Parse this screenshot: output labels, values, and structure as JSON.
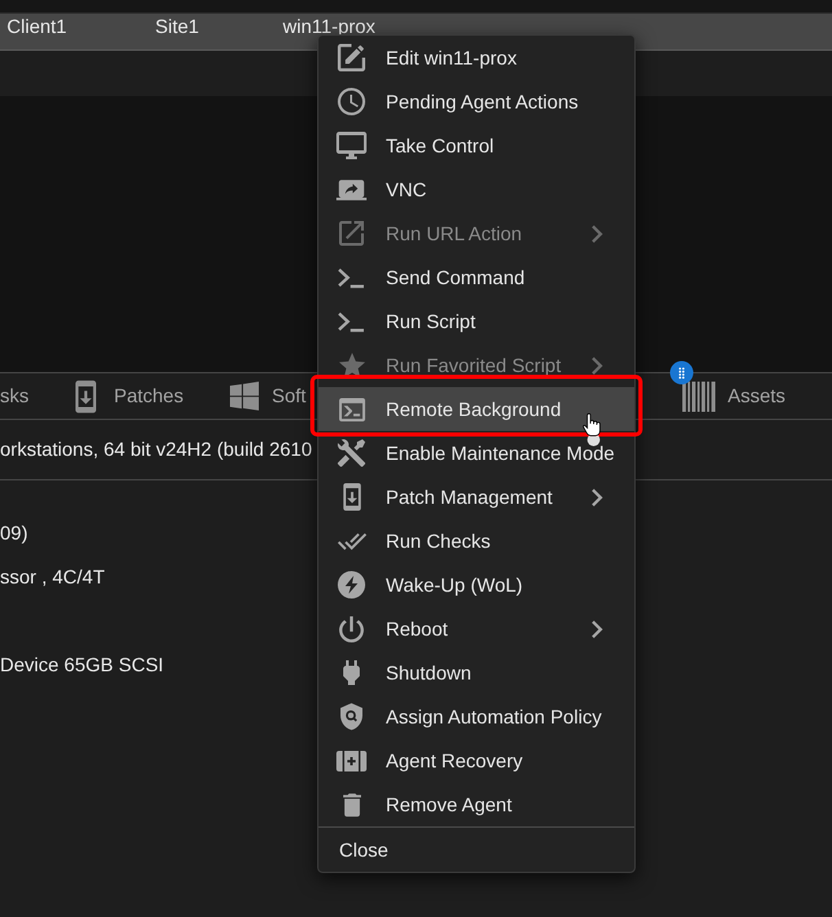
{
  "table_row": {
    "selected": true,
    "cells": [
      "Client1",
      "Site1",
      "win11-prox"
    ]
  },
  "tabs": [
    {
      "label": "sks",
      "badge": false
    },
    {
      "label": "Patches",
      "badge": false
    },
    {
      "label": "Soft",
      "badge": false
    },
    {
      "label": "Assets",
      "badge": true
    }
  ],
  "summary": "orkstations, 64 bit v24H2 (build 2610",
  "details": [
    "09)",
    "ssor , 4C/4T",
    "Device 65GB SCSI"
  ],
  "context_menu": {
    "items": [
      {
        "label": "Edit win11-prox",
        "disabled": false,
        "submenu": false,
        "selected": false,
        "outlined": false
      },
      {
        "label": "Pending Agent Actions",
        "disabled": false,
        "submenu": false,
        "selected": false,
        "outlined": false
      },
      {
        "label": "Take Control",
        "disabled": false,
        "submenu": false,
        "selected": false,
        "outlined": false
      },
      {
        "label": "VNC",
        "disabled": false,
        "submenu": false,
        "selected": false,
        "outlined": false
      },
      {
        "label": "Run URL Action",
        "disabled": true,
        "submenu": true,
        "selected": false,
        "outlined": false
      },
      {
        "label": "Send Command",
        "disabled": false,
        "submenu": false,
        "selected": false,
        "outlined": false
      },
      {
        "label": "Run Script",
        "disabled": false,
        "submenu": false,
        "selected": false,
        "outlined": false
      },
      {
        "label": "Run Favorited Script",
        "disabled": true,
        "submenu": true,
        "selected": false,
        "outlined": false
      },
      {
        "label": "Remote Background",
        "disabled": false,
        "submenu": false,
        "selected": true,
        "outlined": true
      },
      {
        "label": "Enable Maintenance Mode",
        "disabled": false,
        "submenu": false,
        "selected": false,
        "outlined": false
      },
      {
        "label": "Patch Management",
        "disabled": false,
        "submenu": true,
        "selected": false,
        "outlined": false
      },
      {
        "label": "Run Checks",
        "disabled": false,
        "submenu": false,
        "selected": false,
        "outlined": false
      },
      {
        "label": "Wake-Up (WoL)",
        "disabled": false,
        "submenu": false,
        "selected": false,
        "outlined": false
      },
      {
        "label": "Reboot",
        "disabled": false,
        "submenu": true,
        "selected": false,
        "outlined": false
      },
      {
        "label": "Shutdown",
        "disabled": false,
        "submenu": false,
        "selected": false,
        "outlined": false
      },
      {
        "label": "Assign Automation Policy",
        "disabled": false,
        "submenu": false,
        "selected": false,
        "outlined": false
      },
      {
        "label": "Agent Recovery",
        "disabled": false,
        "submenu": false,
        "selected": false,
        "outlined": false
      },
      {
        "label": "Remove Agent",
        "disabled": false,
        "submenu": false,
        "selected": false,
        "outlined": false
      }
    ],
    "close": "Close"
  }
}
